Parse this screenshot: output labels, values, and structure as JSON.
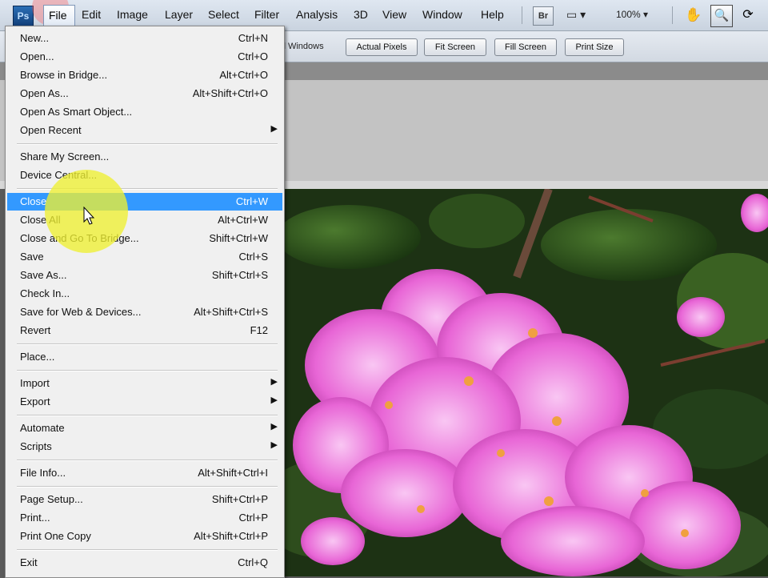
{
  "menubar": {
    "logo": "Ps",
    "items": [
      "File",
      "Edit",
      "Image",
      "Layer",
      "Select",
      "Filter",
      "Analysis",
      "3D",
      "View",
      "Window",
      "Help"
    ],
    "bridge_label": "Br",
    "zoom_level": "100%",
    "icons": [
      "hand-icon",
      "zoom-icon",
      "rotate-view-icon",
      "screen-mode-icon"
    ]
  },
  "options_bar": {
    "all_windows": "ll Windows",
    "buttons": [
      "Actual Pixels",
      "Fit Screen",
      "Fill Screen",
      "Print Size"
    ]
  },
  "file_menu": {
    "groups": [
      [
        {
          "label": "New...",
          "shortcut": "Ctrl+N"
        },
        {
          "label": "Open...",
          "shortcut": "Ctrl+O"
        },
        {
          "label": "Browse in Bridge...",
          "shortcut": "Alt+Ctrl+O"
        },
        {
          "label": "Open As...",
          "shortcut": "Alt+Shift+Ctrl+O"
        },
        {
          "label": "Open As Smart Object...",
          "shortcut": ""
        },
        {
          "label": "Open Recent",
          "shortcut": "",
          "submenu": true
        }
      ],
      [
        {
          "label": "Share My Screen...",
          "shortcut": ""
        },
        {
          "label": "Device Central...",
          "shortcut": ""
        }
      ],
      [
        {
          "label": "Close",
          "shortcut": "Ctrl+W",
          "selected": true
        },
        {
          "label": "Close All",
          "shortcut": "Alt+Ctrl+W"
        },
        {
          "label": "Close and Go To Bridge...",
          "shortcut": "Shift+Ctrl+W"
        },
        {
          "label": "Save",
          "shortcut": "Ctrl+S"
        },
        {
          "label": "Save As...",
          "shortcut": "Shift+Ctrl+S"
        },
        {
          "label": "Check In...",
          "shortcut": ""
        },
        {
          "label": "Save for Web & Devices...",
          "shortcut": "Alt+Shift+Ctrl+S"
        },
        {
          "label": "Revert",
          "shortcut": "F12"
        }
      ],
      [
        {
          "label": "Place...",
          "shortcut": ""
        }
      ],
      [
        {
          "label": "Import",
          "shortcut": "",
          "submenu": true
        },
        {
          "label": "Export",
          "shortcut": "",
          "submenu": true
        }
      ],
      [
        {
          "label": "Automate",
          "shortcut": "",
          "submenu": true
        },
        {
          "label": "Scripts",
          "shortcut": "",
          "submenu": true
        }
      ],
      [
        {
          "label": "File Info...",
          "shortcut": "Alt+Shift+Ctrl+I"
        }
      ],
      [
        {
          "label": "Page Setup...",
          "shortcut": "Shift+Ctrl+P"
        },
        {
          "label": "Print...",
          "shortcut": "Ctrl+P"
        },
        {
          "label": "Print One Copy",
          "shortcut": "Alt+Shift+Ctrl+P"
        }
      ],
      [
        {
          "label": "Exit",
          "shortcut": "Ctrl+Q"
        }
      ]
    ]
  },
  "colors": {
    "selection": "#3399ff",
    "cursor_highlight": "#eef032",
    "menu_bg": "#f0f0f0"
  }
}
